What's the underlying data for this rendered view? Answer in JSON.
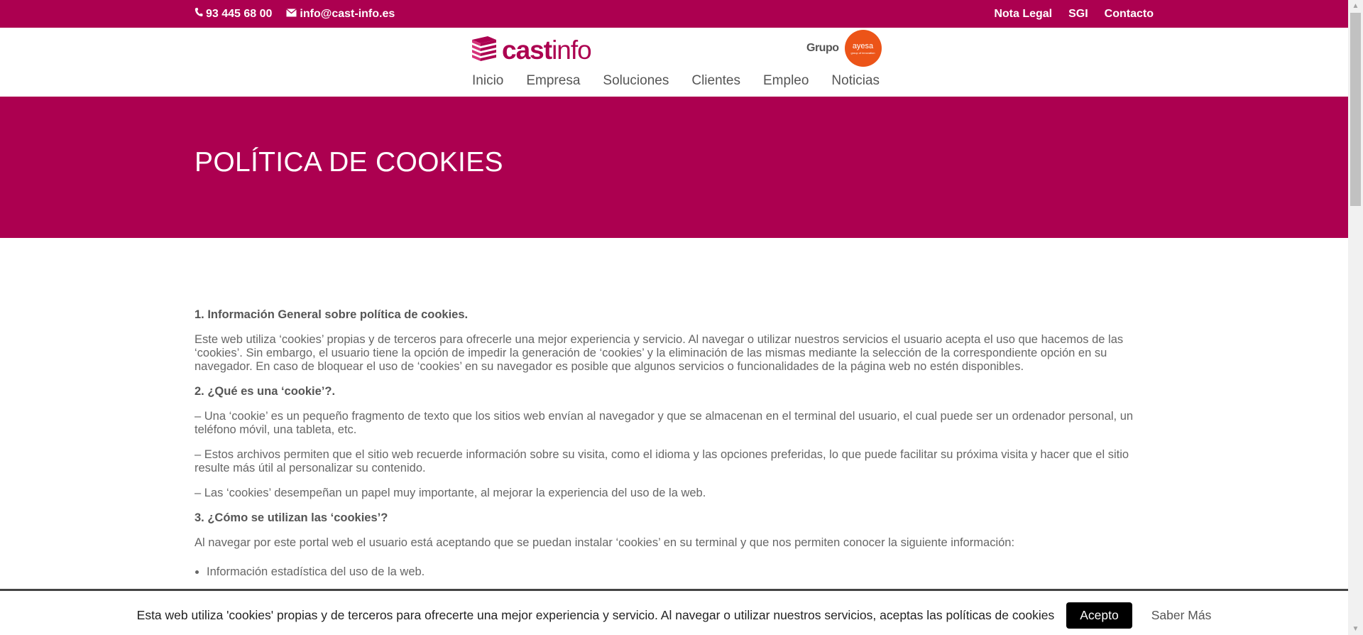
{
  "topbar": {
    "phone": "93 445 68 00",
    "email": "info@cast-info.es",
    "links": [
      "Nota Legal",
      "SGI",
      "Contacto"
    ],
    "background": "#ac0050"
  },
  "header": {
    "logo_bold": "cast",
    "logo_light": "info",
    "grupo_label": "Grupo",
    "grupo_logo": "ayesa",
    "grupo_logo_sub": "group of innovation",
    "nav": [
      "Inicio",
      "Empresa",
      "Soluciones",
      "Clientes",
      "Empleo",
      "Noticias"
    ]
  },
  "hero": {
    "title": "POLÍTICA DE COOKIES"
  },
  "content": {
    "s1_heading": "1. Información General sobre política de cookies.",
    "s1_p1": "Este web utiliza ‘cookies’ propias y de terceros para ofrecerle una mejor experiencia y servicio. Al navegar o utilizar nuestros servicios el usuario acepta el uso que hacemos de las ‘cookies’. Sin embargo, el usuario tiene la opción de impedir la generación de ‘cookies’ y la eliminación de las mismas mediante la selección de la correspondiente opción en su navegador. En caso de bloquear el uso de ‘cookies’ en su navegador es posible que algunos servicios o funcionalidades de la página web no estén disponibles.",
    "s2_heading": "2. ¿Qué es una ‘cookie’?.",
    "s2_p1": "– Una ‘cookie’ es un pequeño fragmento de texto que los sitios web envían al navegador y que se almacenan en el terminal del usuario, el cual puede ser un ordenador personal, un teléfono móvil, una tableta, etc.",
    "s2_p2": "– Estos archivos permiten que el sitio web recuerde información sobre su visita, como el idioma y las opciones preferidas, lo que puede facilitar su próxima visita y hacer que el sitio resulte más útil al personalizar su contenido.",
    "s2_p3": "– Las ‘cookies’ desempeñan un papel muy importante, al mejorar la experiencia del uso de la web.",
    "s3_heading": "3. ¿Cómo se utilizan las ‘cookies’?",
    "s3_p1": "Al navegar por este portal web el usuario está aceptando que se puedan instalar ‘cookies’ en su terminal y que nos permiten conocer la siguiente información:",
    "s3_list": [
      "Información estadística del uso de la web."
    ]
  },
  "cookie_bar": {
    "text": "Esta web utiliza 'cookies' propias y de terceros para ofrecerte una mejor experiencia y servicio. Al navegar o utilizar nuestros servicios, aceptas las políticas de cookies",
    "accept_label": "Acepto",
    "more_label": "Saber Más"
  },
  "icons": {
    "phone": "phone-icon",
    "email": "envelope-icon",
    "logo": "castinfo-logo-mark",
    "scroll_up": "scroll-up-arrow-icon",
    "scroll_down": "scroll-down-arrow-icon"
  }
}
